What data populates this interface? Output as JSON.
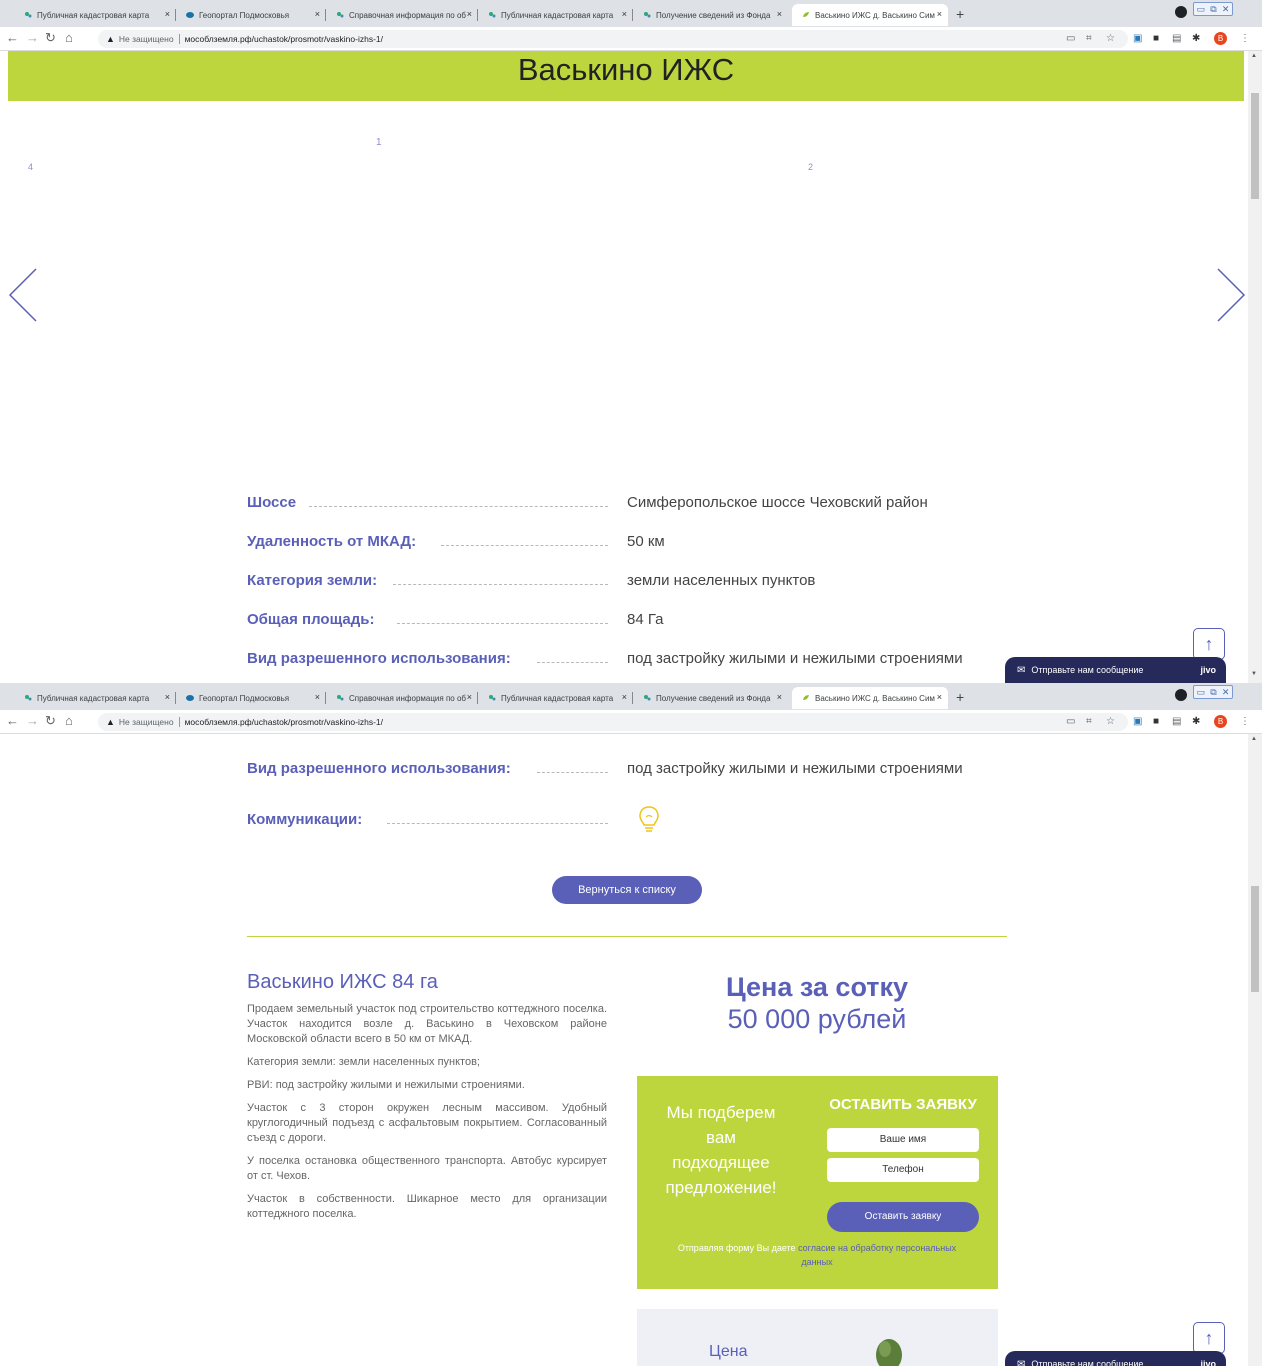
{
  "browser": {
    "tabs": [
      {
        "title": "Публичная кадастровая карта",
        "active": false
      },
      {
        "title": "Геопортал Подмосковья",
        "active": false
      },
      {
        "title": "Справочная информация по об",
        "active": false
      },
      {
        "title": "Публичная кадастровая карта",
        "active": false
      },
      {
        "title": "Получение сведений из Фонда",
        "active": false
      },
      {
        "title": "Васькино ИЖС д. Васькино Сим",
        "active": true
      }
    ],
    "close_glyph": "×",
    "new_tab_glyph": "+",
    "insecure_label": "Не защищено",
    "url": "мособлземля.рф/uchastok/prosmotr/vaskino-izhs-1/",
    "profile_initial": "В",
    "icons": [
      "back-icon",
      "forward-icon",
      "reload-icon",
      "home-icon",
      "warning-icon",
      "cast-icon",
      "translate-icon",
      "star-icon",
      "extensions-icon",
      "puzzle-icon"
    ]
  },
  "page": {
    "banner_title": "Васькино ИЖС",
    "slide_numbers": [
      "1",
      "4",
      "2"
    ],
    "properties": [
      {
        "label": "Шоссе",
        "value": "Симферопольское шоссе Чеховский район"
      },
      {
        "label": "Удаленность от МКАД:",
        "value": "50  км"
      },
      {
        "label": "Категория земли:",
        "value": "земли населенных пунктов"
      },
      {
        "label": "Общая площадь:",
        "value": "84  Га"
      },
      {
        "label": "Вид разрешенного использования:",
        "value": "под застройку жилыми и нежилыми строениями"
      },
      {
        "label": "Коммуникации:",
        "value": ""
      }
    ],
    "back_button": "Вернуться к списку",
    "description": {
      "title": "Васькино ИЖС 84 га",
      "paragraphs": [
        "Продаем земельный участок под строительство коттеджного поселка. Участок находится возле д. Васькино в Чеховском районе Московской области всего в 50 км от МКАД.",
        "Категория земли: земли населенных пунктов;",
        "РВИ: под застройку жилыми и нежилыми строениями.",
        "Участок с 3 сторон окружен лесным массивом. Удобный круглогодичный подъезд с асфальтовым покрытием. Согласованный съезд с дороги.",
        "У поселка остановка общественного транспорта. Автобус курсирует от ст. Чехов.",
        "Участок в собственности. Шикарное место для организации коттеджного поселка."
      ]
    },
    "price": {
      "line1": "Цена за сотку",
      "line2": "50 000 рублей"
    },
    "form": {
      "left_text": "Мы подберем вам подходящее предложение!",
      "title": "ОСТАВИТЬ ЗАЯВКУ",
      "name_placeholder": "Ваше имя",
      "phone_placeholder": "Телефон",
      "submit": "Оставить заявку",
      "consent_prefix": "Отправляя форму Вы даете",
      "consent_link": "согласие на обработку персональных данных"
    },
    "next_card_word": "Цена",
    "chat_widget": {
      "label": "Отправьте нам сообщение",
      "brand": "jivo"
    },
    "up_button_glyph": "↑",
    "colors": {
      "green": "#bdd63d",
      "purple": "#5a5fb8",
      "chat": "#262a5b"
    }
  }
}
